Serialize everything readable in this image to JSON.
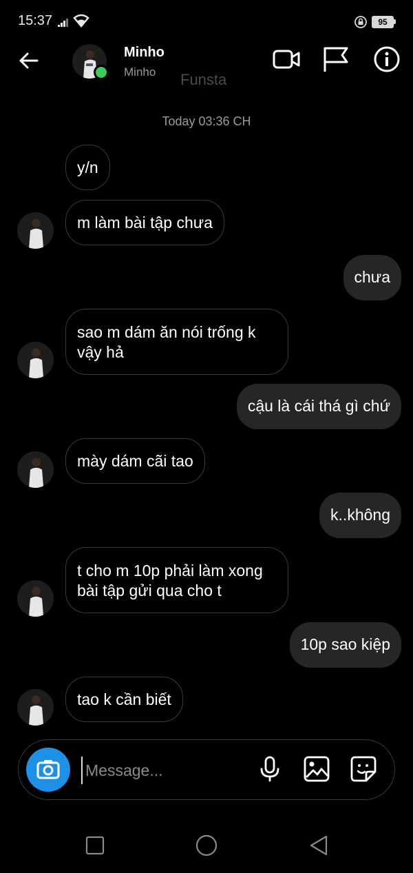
{
  "status_bar": {
    "time": "15:37",
    "battery": "95"
  },
  "header": {
    "name": "Minho",
    "username": "Minho",
    "watermark": "Funsta"
  },
  "conversation": {
    "date_separator": "Today 03:36 CH",
    "messages": [
      {
        "id": "m1",
        "side": "incoming",
        "text": "y/n"
      },
      {
        "id": "m2",
        "side": "incoming",
        "text": "m làm bài tập chưa"
      },
      {
        "id": "m3",
        "side": "outgoing",
        "text": "chưa"
      },
      {
        "id": "m4",
        "side": "incoming",
        "text": "sao m dám ăn nói trống k vậy hả"
      },
      {
        "id": "m5",
        "side": "outgoing",
        "text": "cậu là cái thá gì chứ"
      },
      {
        "id": "m6",
        "side": "incoming",
        "text": "mày dám cãi tao"
      },
      {
        "id": "m7",
        "side": "outgoing",
        "text": "k..không"
      },
      {
        "id": "m8",
        "side": "incoming",
        "text": "t cho m 10p phải làm xong bài tập gửi qua cho t"
      },
      {
        "id": "m9",
        "side": "outgoing",
        "text": "10p sao kiệp"
      },
      {
        "id": "m10",
        "side": "incoming",
        "text": "tao k cần biết"
      }
    ]
  },
  "composer": {
    "placeholder": "Message..."
  },
  "colors": {
    "background": "#000000",
    "incoming_border": "#3a3a3a",
    "outgoing_bubble": "#262626",
    "camera_button": "#1e90e8",
    "online": "#3ec95c"
  },
  "icons": [
    "back-arrow-icon",
    "video-call-icon",
    "flag-icon",
    "info-icon",
    "camera-icon",
    "microphone-icon",
    "gallery-icon",
    "sticker-icon"
  ]
}
